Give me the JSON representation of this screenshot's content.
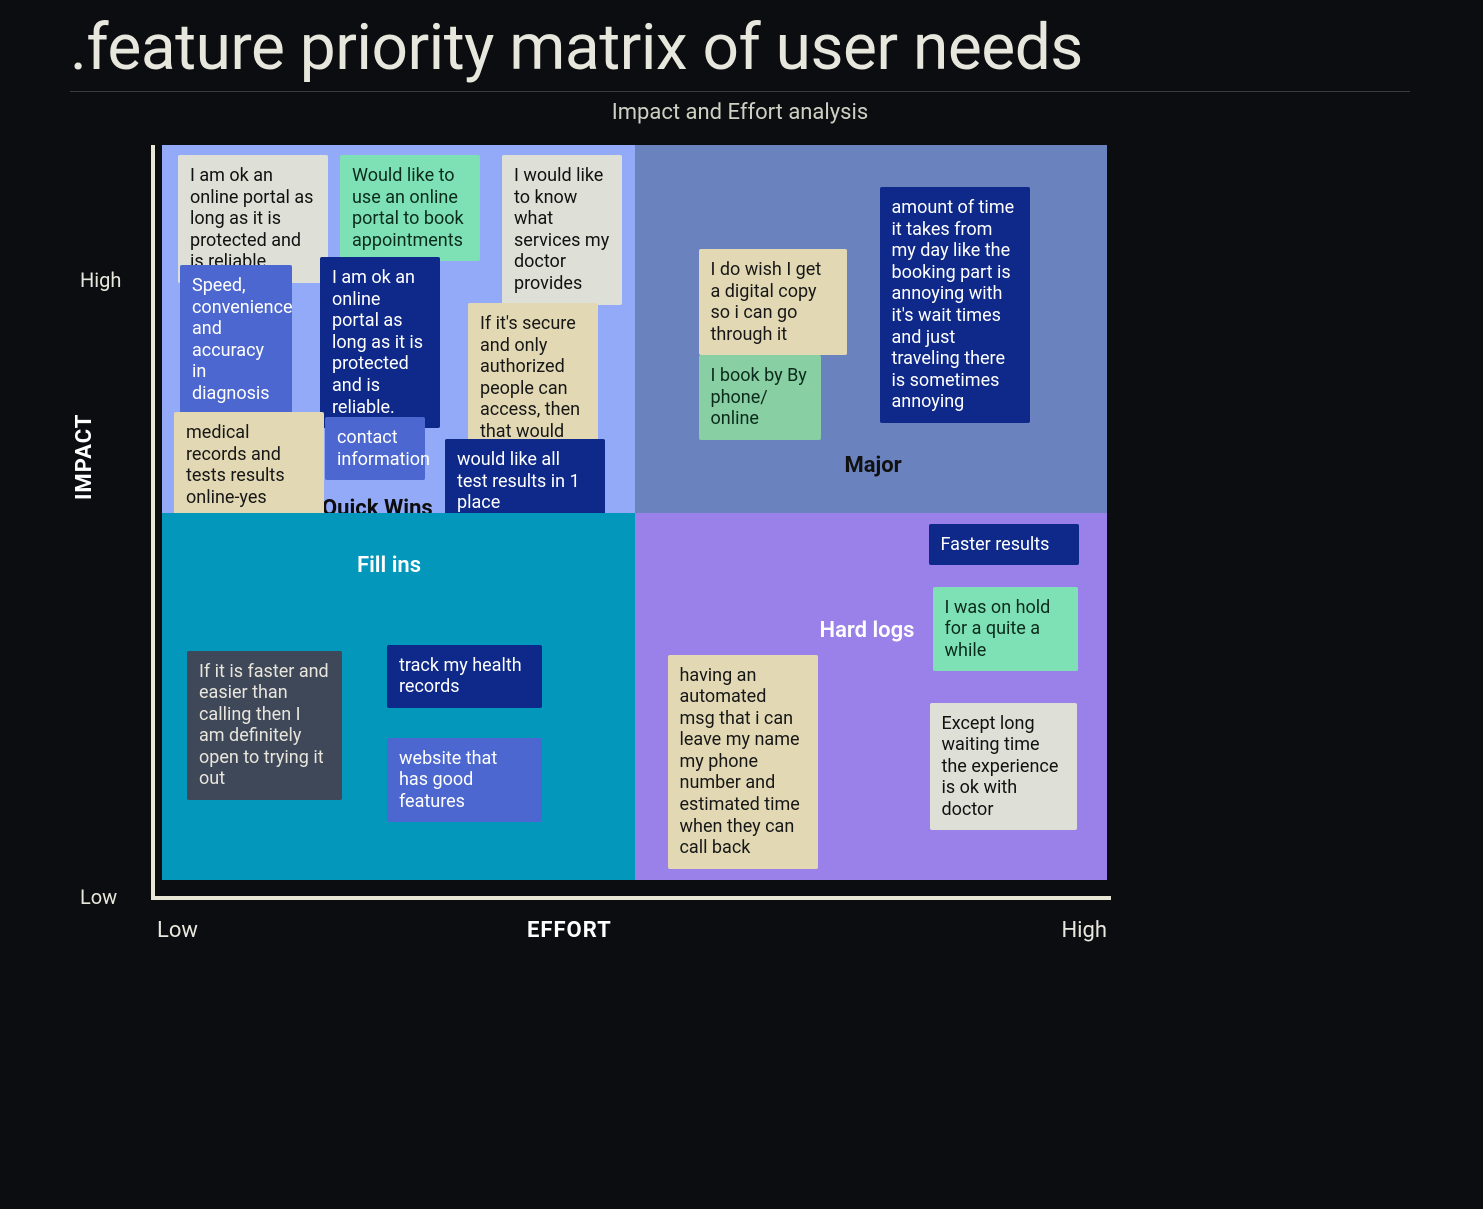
{
  "title": ".feature priority matrix of user needs",
  "subtitle": "Impact and Effort analysis",
  "axes": {
    "y_label": "IMPACT",
    "x_label": "EFFORT",
    "y_high": "High",
    "y_low": "Low",
    "x_low": "Low",
    "x_high": "High"
  },
  "quadrants": {
    "quick_wins": {
      "label": "Quick Wins",
      "cards": {
        "portal_protected": "I am ok an online portal as long as it is protected and is reliable.",
        "book_appts": "Would like to use an online portal to book appointments",
        "services_doctor": "I would like to know what services my doctor provides",
        "speed_accuracy": "Speed, convenience and accuracy in diagnosis",
        "portal_protected2": "I am ok an online portal as long as it is protected and is reliable.",
        "secure_access": "If it's secure and only authorized people can access, then that would be great.",
        "records_online": "medical records and tests results online-yes",
        "contact_info": "contact information",
        "tests_one_place": "would like all test results in 1 place"
      }
    },
    "major": {
      "label": "Major",
      "cards": {
        "digital_copy": "I do wish I get a digital copy so i can go through it",
        "book_by": "I book by By phone/ online",
        "time_takes": "amount of time it takes from my day like the booking part is annoying with it's wait times and just traveling there is sometimes annoying"
      }
    },
    "fill_ins": {
      "label": "Fill ins",
      "cards": {
        "faster_than_call": "If it is faster and easier than calling then I am definitely open to trying it out",
        "track_health": " track my health records",
        "website_features": "website that has good features"
      }
    },
    "hard_logs": {
      "label": "Hard logs",
      "cards": {
        "automated_msg": "having an automated msg that i can leave my name my phone number and estimated time when they can  call back",
        "faster_results": "Faster results",
        "on_hold": "I was on hold for a quite a while",
        "long_wait": "Except long waiting time the experience is ok with doctor"
      }
    }
  }
}
